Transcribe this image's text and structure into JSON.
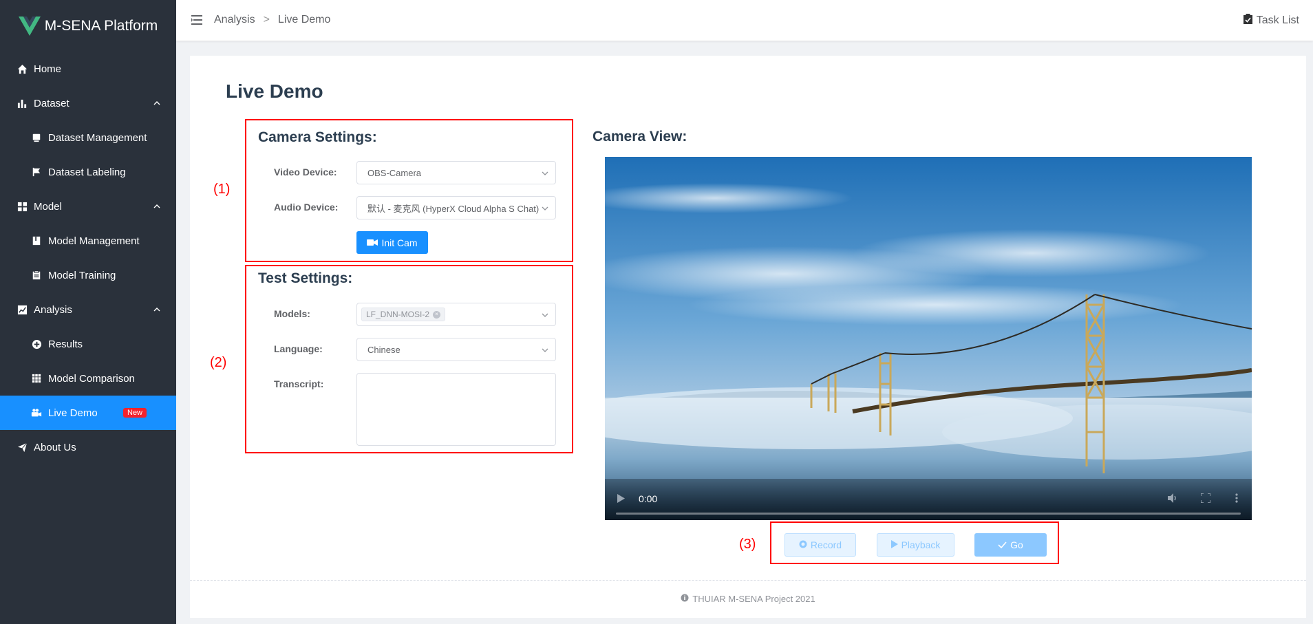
{
  "app": {
    "title": "M-SENA Platform",
    "brand_color": "#1890ff"
  },
  "sidebar": {
    "items": [
      {
        "label": "Home",
        "icon": "home-icon"
      },
      {
        "label": "Dataset",
        "icon": "bar-chart-icon",
        "expanded": true
      },
      {
        "label": "Dataset Management",
        "icon": "database-icon"
      },
      {
        "label": "Dataset Labeling",
        "icon": "flag-icon"
      },
      {
        "label": "Model",
        "icon": "grid-icon",
        "expanded": true
      },
      {
        "label": "Model Management",
        "icon": "book-icon"
      },
      {
        "label": "Model Training",
        "icon": "clipboard-icon"
      },
      {
        "label": "Analysis",
        "icon": "line-chart-icon",
        "expanded": true
      },
      {
        "label": "Results",
        "icon": "plus-circle-icon"
      },
      {
        "label": "Model Comparison",
        "icon": "table-grid-icon"
      },
      {
        "label": "Live Demo",
        "icon": "video-camera-icon",
        "badge": "New",
        "active": true
      },
      {
        "label": "About Us",
        "icon": "send-icon"
      }
    ]
  },
  "header": {
    "breadcrumb": [
      "Analysis",
      "Live Demo"
    ],
    "breadcrumb_separator": ">",
    "task_list": "Task List"
  },
  "main": {
    "title": "Live Demo",
    "annotations": [
      "(1)",
      "(2)",
      "(3)"
    ],
    "camera_settings": {
      "title": "Camera Settings:",
      "video_device_label": "Video Device:",
      "video_device_value": "OBS-Camera",
      "audio_device_label": "Audio Device:",
      "audio_device_value": "默认 - 麦克风 (HyperX Cloud Alpha S Chat)",
      "init_button": "Init Cam"
    },
    "test_settings": {
      "title": "Test Settings:",
      "models_label": "Models:",
      "models_tag": "LF_DNN-MOSI-2",
      "language_label": "Language:",
      "language_value": "Chinese",
      "transcript_label": "Transcript:",
      "transcript_value": ""
    },
    "camera_view": {
      "title": "Camera View:",
      "time": "0:00"
    },
    "actions": {
      "record": "Record",
      "playback": "Playback",
      "go": "Go"
    },
    "footer": "THUIAR M-SENA Project 2021"
  }
}
